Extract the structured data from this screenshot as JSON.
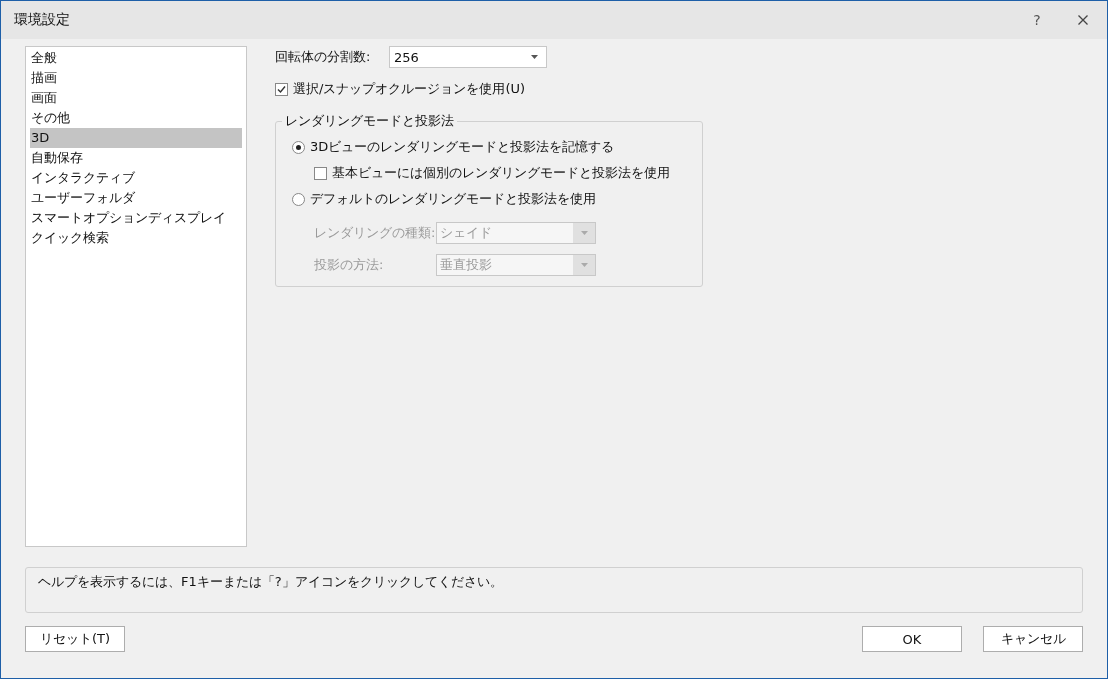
{
  "window": {
    "title": "環境設定",
    "help_button": "?"
  },
  "sidebar": {
    "items": [
      {
        "label": "全般",
        "selected": false
      },
      {
        "label": "描画",
        "selected": false
      },
      {
        "label": "画面",
        "selected": false
      },
      {
        "label": "その他",
        "selected": false
      },
      {
        "label": "3D",
        "selected": true
      },
      {
        "label": "自動保存",
        "selected": false
      },
      {
        "label": "インタラクティブ",
        "selected": false
      },
      {
        "label": "ユーザーフォルダ",
        "selected": false
      },
      {
        "label": "スマートオプションディスプレイ",
        "selected": false
      },
      {
        "label": "クイック検索",
        "selected": false
      }
    ]
  },
  "subdivisions": {
    "label": "回転体の分割数:",
    "value": "256"
  },
  "occlusion": {
    "label": "選択/スナップオクルージョンを使用(U)",
    "checked": true
  },
  "rendering_group": {
    "title": "レンダリングモードと投影法",
    "options": [
      {
        "label": "3Dビューのレンダリングモードと投影法を記憶する",
        "selected": true
      },
      {
        "label": "デフォルトのレンダリングモードと投影法を使用",
        "selected": false
      }
    ],
    "per_view": {
      "label": "基本ビューには個別のレンダリングモードと投影法を使用",
      "checked": false
    },
    "fields": [
      {
        "label": "レンダリングの種類:",
        "value": "シェイド",
        "disabled": true
      },
      {
        "label": "投影の方法:",
        "value": "垂直投影",
        "disabled": true
      }
    ]
  },
  "help_text": "ヘルプを表示するには、F1キーまたは「?」アイコンをクリックしてください。",
  "buttons": {
    "reset": "リセット(T)",
    "ok": "OK",
    "cancel": "キャンセル"
  }
}
